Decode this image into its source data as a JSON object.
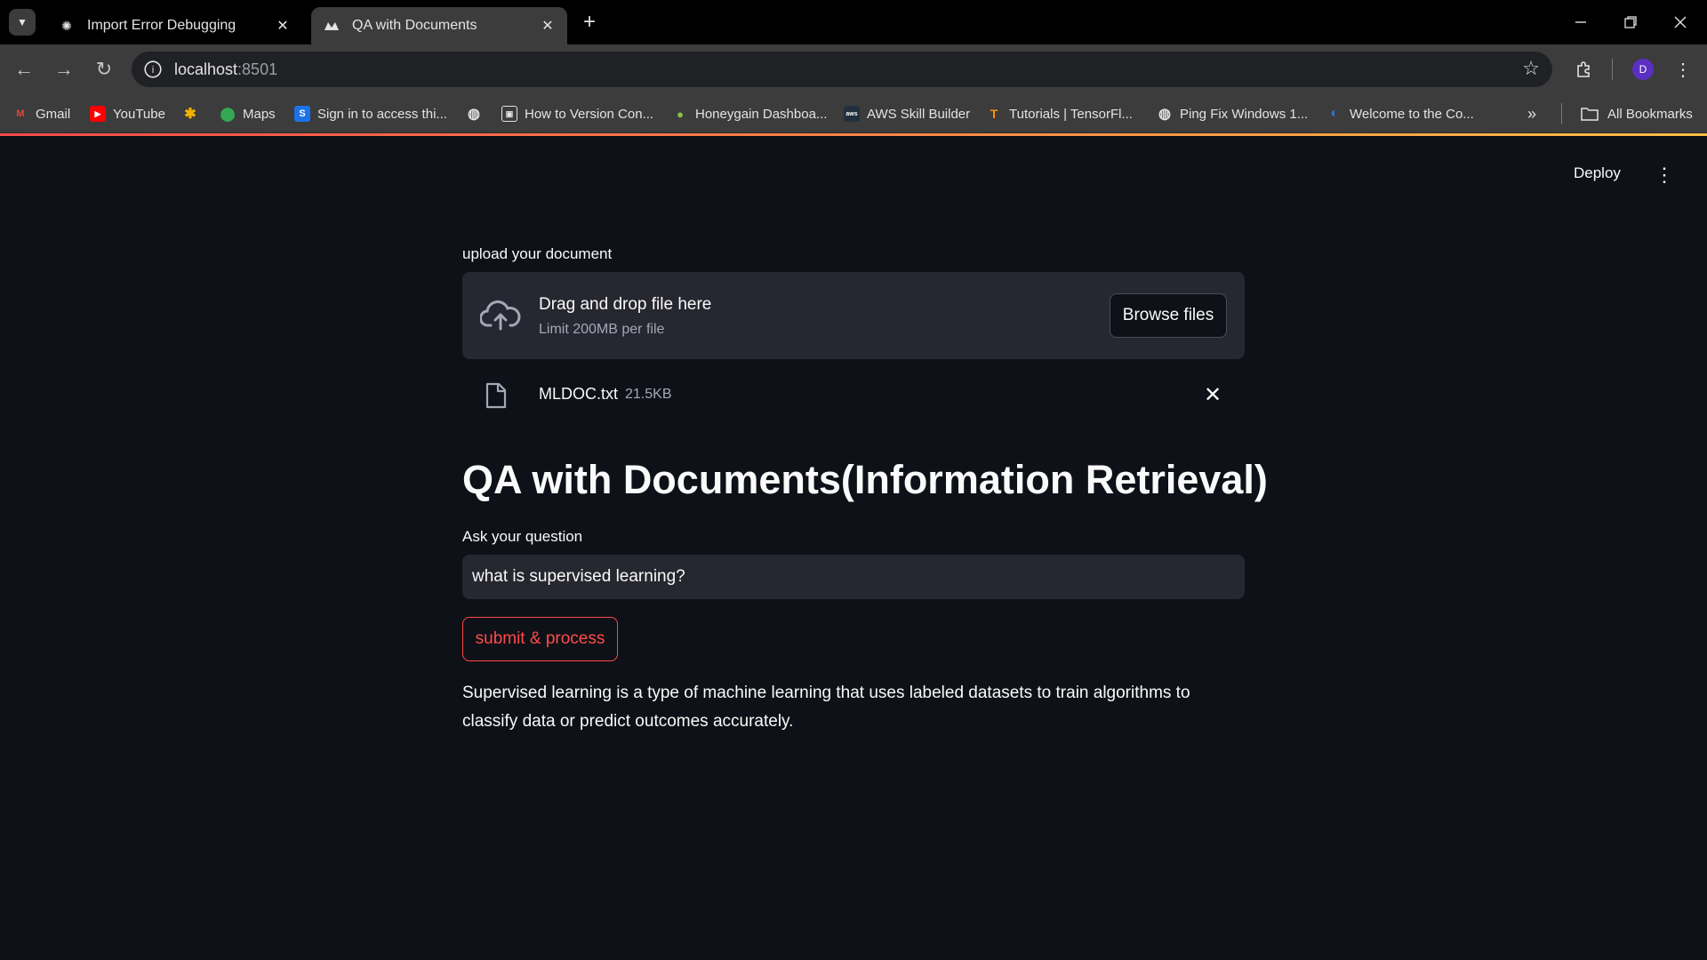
{
  "browser": {
    "tabs": [
      {
        "title": "Import Error Debugging",
        "favicon": "openai-icon",
        "active": false
      },
      {
        "title": "QA with Documents",
        "favicon": "streamlit-icon",
        "active": true
      }
    ],
    "url_host": "localhost",
    "url_port": ":8501",
    "profile_initial": "D",
    "bookmarks": [
      {
        "label": "Gmail",
        "icon": "gmail-icon"
      },
      {
        "label": "YouTube",
        "icon": "youtube-icon"
      },
      {
        "label": "",
        "icon": "kaggle-icon"
      },
      {
        "label": "Maps",
        "icon": "maps-icon"
      },
      {
        "label": "Sign in to access thi...",
        "icon": "s-icon"
      },
      {
        "label": "",
        "icon": "globe-icon"
      },
      {
        "label": "How to Version Con...",
        "icon": "dvc-icon"
      },
      {
        "label": "Honeygain Dashboa...",
        "icon": "honeygain-icon"
      },
      {
        "label": "AWS Skill Builder",
        "icon": "aws-icon"
      },
      {
        "label": "Tutorials  |  TensorFl...",
        "icon": "tensorflow-icon"
      },
      {
        "label": "Ping Fix Windows 1...",
        "icon": "globe-icon"
      },
      {
        "label": "Welcome to the Co...",
        "icon": "coursera-icon"
      }
    ],
    "all_bookmarks": "All Bookmarks"
  },
  "app": {
    "deploy_label": "Deploy",
    "upload_label": "upload your document",
    "dropzone_title": "Drag and drop file here",
    "dropzone_limit": "Limit 200MB per file",
    "browse_label": "Browse files",
    "file": {
      "name": "MLDOC.txt",
      "size": "21.5KB"
    },
    "title": "QA with Documents(Information Retrieval)",
    "question_label": "Ask your question",
    "question_value": "what is supervised learning?",
    "submit_label": "submit & process",
    "answer": "Supervised learning is a type of machine learning that uses labeled datasets to train algorithms to classify data or predict outcomes accurately."
  }
}
